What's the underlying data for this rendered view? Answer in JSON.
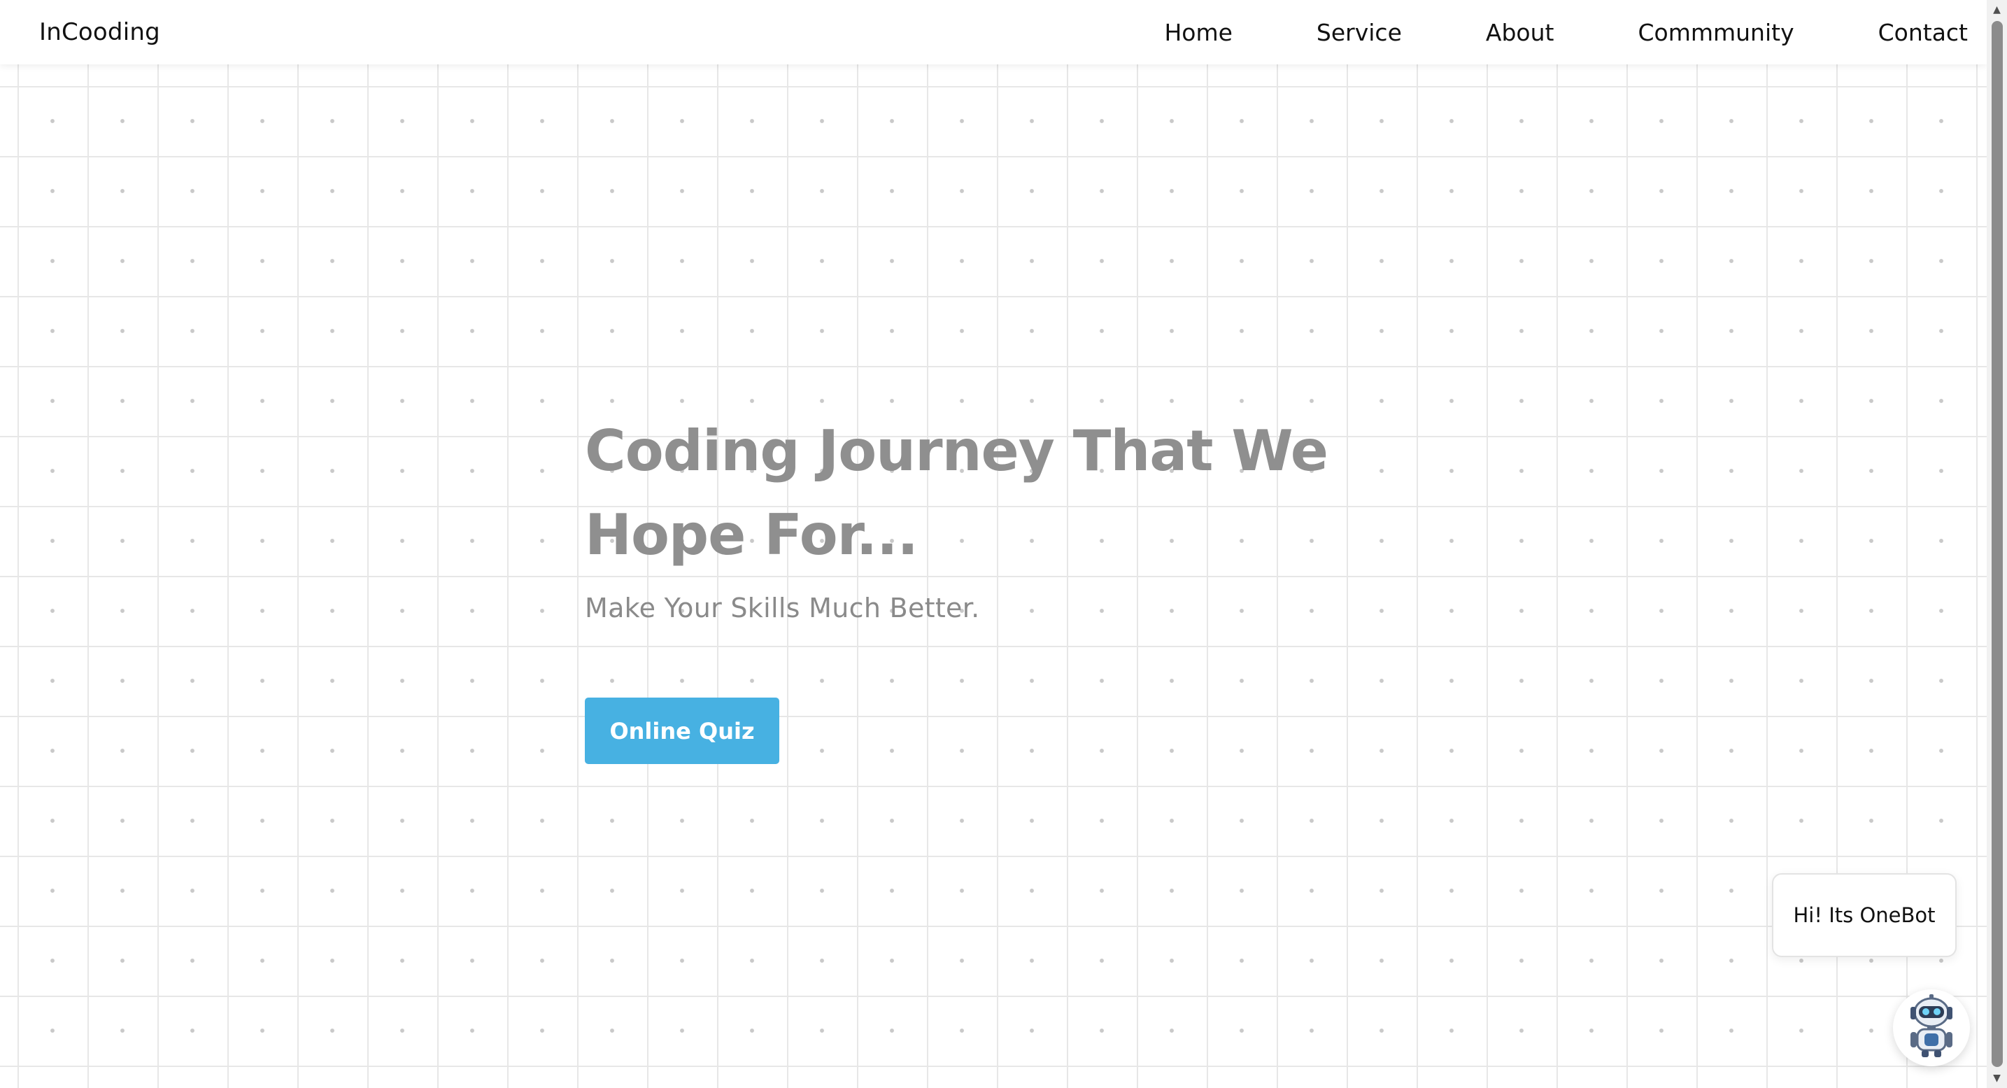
{
  "navbar": {
    "brand": "InCooding",
    "links": [
      "Home",
      "Service",
      "About",
      "Commmunity",
      "Contact"
    ]
  },
  "hero": {
    "title": "Coding Journey That We Hope For...",
    "subtitle": "Make Your Skills Much Better.",
    "cta_label": "Online Quiz"
  },
  "chatbot": {
    "greeting": "Hi! Its OneBot",
    "avatar_icon": "robot-icon"
  },
  "colors": {
    "accent": "#47b1e2",
    "title_gray": "#8f8f8f",
    "grid_line": "#e7e7e7"
  }
}
